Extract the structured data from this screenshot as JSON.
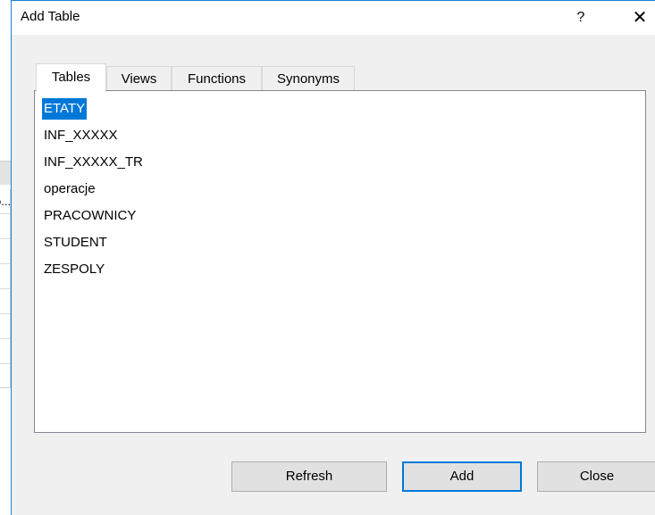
{
  "background_window": {
    "rows": [
      "o...",
      "",
      "",
      "",
      "",
      "",
      ""
    ]
  },
  "dialog": {
    "title": "Add Table",
    "help_label": "?",
    "close_label": "✕"
  },
  "tabs": [
    {
      "label": "Tables",
      "active": true
    },
    {
      "label": "Views",
      "active": false
    },
    {
      "label": "Functions",
      "active": false
    },
    {
      "label": "Synonyms",
      "active": false
    }
  ],
  "tables": [
    {
      "label": "ETATY",
      "selected": true
    },
    {
      "label": "INF_XXXXX",
      "selected": false
    },
    {
      "label": "INF_XXXXX_TR",
      "selected": false
    },
    {
      "label": "operacje",
      "selected": false
    },
    {
      "label": "PRACOWNICY",
      "selected": false
    },
    {
      "label": "STUDENT",
      "selected": false
    },
    {
      "label": "ZESPOLY",
      "selected": false
    }
  ],
  "buttons": {
    "refresh": "Refresh",
    "add": "Add",
    "close": "Close"
  },
  "colors": {
    "accent": "#0078d7",
    "border": "#1883d7"
  }
}
